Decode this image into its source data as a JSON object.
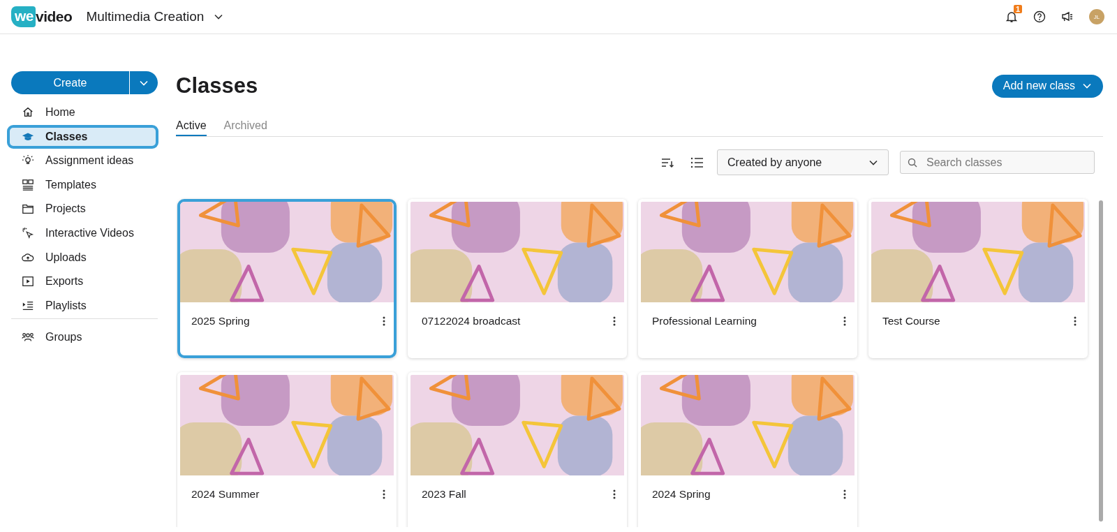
{
  "topbar": {
    "logo": {
      "part_1": "we",
      "part_2": "video"
    },
    "workspace": "Multimedia Creation",
    "notification_count": "1",
    "avatar_initials": "JL"
  },
  "sidebar": {
    "create_button": "Create",
    "items": [
      {
        "label": "Home",
        "selected": false
      },
      {
        "label": "Classes",
        "selected": true
      },
      {
        "label": "Assignment ideas",
        "selected": false
      },
      {
        "label": "Templates",
        "selected": false
      },
      {
        "label": "Projects",
        "selected": false
      },
      {
        "label": "Interactive Videos",
        "selected": false
      },
      {
        "label": "Uploads",
        "selected": false
      },
      {
        "label": "Exports",
        "selected": false
      },
      {
        "label": "Playlists",
        "selected": false
      }
    ],
    "footer_items": [
      {
        "label": "Groups",
        "selected": false
      }
    ]
  },
  "main": {
    "title": "Classes",
    "add_button": "Add new class",
    "tabs": [
      {
        "label": "Active",
        "selected": true
      },
      {
        "label": "Archived",
        "selected": false
      }
    ],
    "filter": {
      "value": "Created by anyone"
    },
    "search": {
      "placeholder": "Search classes"
    },
    "cards": [
      {
        "title": "2025 Spring",
        "selected": true
      },
      {
        "title": "07122024 broadcast",
        "selected": false
      },
      {
        "title": "Professional Learning",
        "selected": false
      },
      {
        "title": "Test Course",
        "selected": false
      },
      {
        "title": "2024 Summer",
        "selected": false
      },
      {
        "title": "2023 Fall",
        "selected": false
      },
      {
        "title": "2024 Spring",
        "selected": false
      }
    ]
  }
}
